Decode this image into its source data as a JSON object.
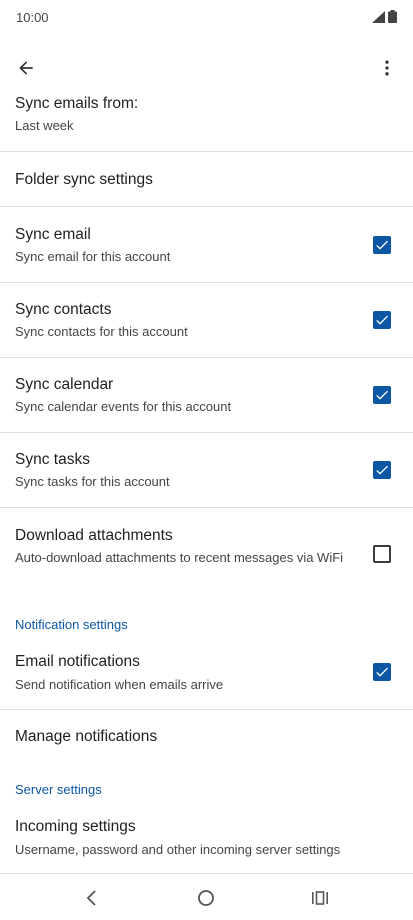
{
  "status_bar": {
    "time": "10:00",
    "signal_icon": "signal-icon",
    "battery_icon": "battery-icon"
  },
  "app_bar": {
    "back_icon": "arrow-back-icon",
    "more_icon": "more-vert-icon"
  },
  "sync_emails_from": {
    "title": "Sync emails from:",
    "value": "Last week"
  },
  "folder_sync": {
    "title": "Folder sync settings"
  },
  "sync_email": {
    "title": "Sync email",
    "subtitle": "Sync email for this account",
    "checked": true
  },
  "sync_contacts": {
    "title": "Sync contacts",
    "subtitle": "Sync contacts for this account",
    "checked": true
  },
  "sync_calendar": {
    "title": "Sync calendar",
    "subtitle": "Sync calendar events for this account",
    "checked": true
  },
  "sync_tasks": {
    "title": "Sync tasks",
    "subtitle": "Sync tasks for this account",
    "checked": true
  },
  "download_attachments": {
    "title": "Download attachments",
    "subtitle": "Auto-download attachments to recent messages via WiFi",
    "checked": false
  },
  "notification_section": {
    "header": "Notification settings"
  },
  "email_notifications": {
    "title": "Email notifications",
    "subtitle": "Send notification when emails arrive",
    "checked": true
  },
  "manage_notifications": {
    "title": "Manage notifications"
  },
  "server_section": {
    "header": "Server settings"
  },
  "incoming_settings": {
    "title": "Incoming settings",
    "subtitle": "Username, password and other incoming server settings"
  },
  "nav_bar": {
    "back_icon": "nav-back-icon",
    "home_icon": "nav-home-icon",
    "recents_icon": "nav-recents-icon"
  },
  "colors": {
    "accent": "#0b57a4",
    "divider": "#e0e0e0",
    "text_primary": "#1f1f1f",
    "text_secondary": "#444444"
  }
}
